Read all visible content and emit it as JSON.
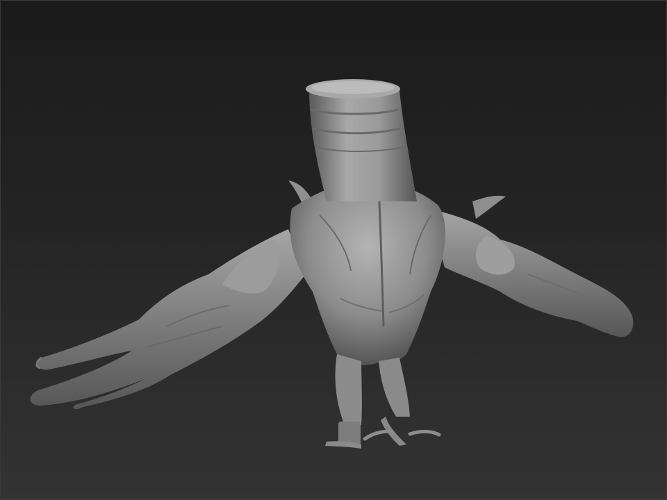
{
  "viewport": {
    "background_top": "#1b1b1b",
    "background_bottom": "#333333",
    "model_color": "#8a8a8a"
  },
  "model": {
    "subject": "sculpted-creature-back-view"
  }
}
